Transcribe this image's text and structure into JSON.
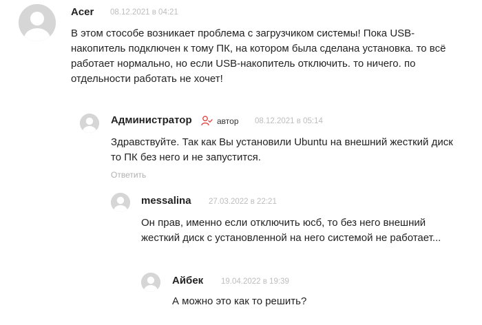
{
  "colors": {
    "avatar_bg": "#d6d6d6",
    "avatar_fg": "#ffffff",
    "date": "#bdbdbd",
    "author_icon": "#e04848"
  },
  "comments": [
    {
      "author": "Acer",
      "date": "08.12.2021 в 04:21",
      "text_lines": [
        "В этом стособе возникает проблема с загрузчиком системы! Пока USB-",
        "накопитель подключен к тому ПК, на котором была сделана установка. то всё",
        "работает нормально, но если USB-накопитель отключить. то ничего. по",
        "отдельности работать не хочет!"
      ]
    },
    {
      "author": "Администратор",
      "author_badge": "автор",
      "author_icon": "user-check-icon",
      "date": "08.12.2021 в 05:14",
      "text_lines": [
        "Здравствуйте. Так как Вы установили Ubuntu на внешний жесткий диск",
        "то ПК без него и не запустится."
      ],
      "reply_label": "Ответить"
    },
    {
      "author": "messalina",
      "date": "27.03.2022 в 22:21",
      "text_lines": [
        "Он прав, именно если отключить юсб, то без него внешний",
        "жесткий диск с установленной на него системой не работает..."
      ]
    },
    {
      "author": "Айбек",
      "date": "19.04.2022 в 19:39",
      "text_lines": [
        "А можно это как то решить?"
      ]
    }
  ]
}
